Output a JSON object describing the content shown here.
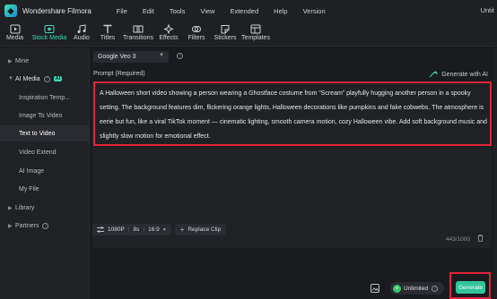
{
  "app": {
    "title": "Wondershare Filmora",
    "title_right": "Untit"
  },
  "menu": [
    "File",
    "Edit",
    "Tools",
    "View",
    "Extended",
    "Help",
    "Version"
  ],
  "toolbar": [
    {
      "label": "Media",
      "icon": "media-icon"
    },
    {
      "label": "Stock Media",
      "icon": "stock-media-icon",
      "active": true
    },
    {
      "label": "Audio",
      "icon": "audio-icon"
    },
    {
      "label": "Titles",
      "icon": "titles-icon"
    },
    {
      "label": "Transitions",
      "icon": "transitions-icon"
    },
    {
      "label": "Effects",
      "icon": "effects-icon"
    },
    {
      "label": "Filters",
      "icon": "filters-icon"
    },
    {
      "label": "Stickers",
      "icon": "stickers-icon"
    },
    {
      "label": "Templates",
      "icon": "templates-icon"
    }
  ],
  "sidebar": {
    "mine": "Mine",
    "ai_media": "AI Media",
    "ai_badge": "AI",
    "items": [
      "Inspiration Temp...",
      "Image To Video",
      "Text to Video",
      "Video Extend",
      "AI Image",
      "My File"
    ],
    "active_item": "Text to Video",
    "library": "Library",
    "partners": "Partners"
  },
  "main": {
    "model": "Google Veo 3",
    "prompt_label": "Prompt (Required)",
    "generate_with_ai": "Generate with AI",
    "prompt_text": "A Halloween short video showing a person wearing a Ghostface costume from “Scream” playfully hugging another person in a spooky setting. The background features dim, flickering orange lights, Halloween decorations like pumpkins and fake cobwebs. The atmosphere is eerie but fun, like a viral TikTok moment — cinematic lighting, smooth camera motion, cozy Halloween vibe. Add soft background music and slightly slow motion for emotional effect.",
    "char_count": "443/1000",
    "resolution": "1080P",
    "duration": "8s",
    "aspect_ratio": "16:9",
    "replace_clip": "Replace Clip",
    "unlimited": "Unlimited",
    "generate": "Generate"
  },
  "colors": {
    "accent": "#36d8b2",
    "highlight": "#e0243c",
    "generate": "#32c49c"
  }
}
